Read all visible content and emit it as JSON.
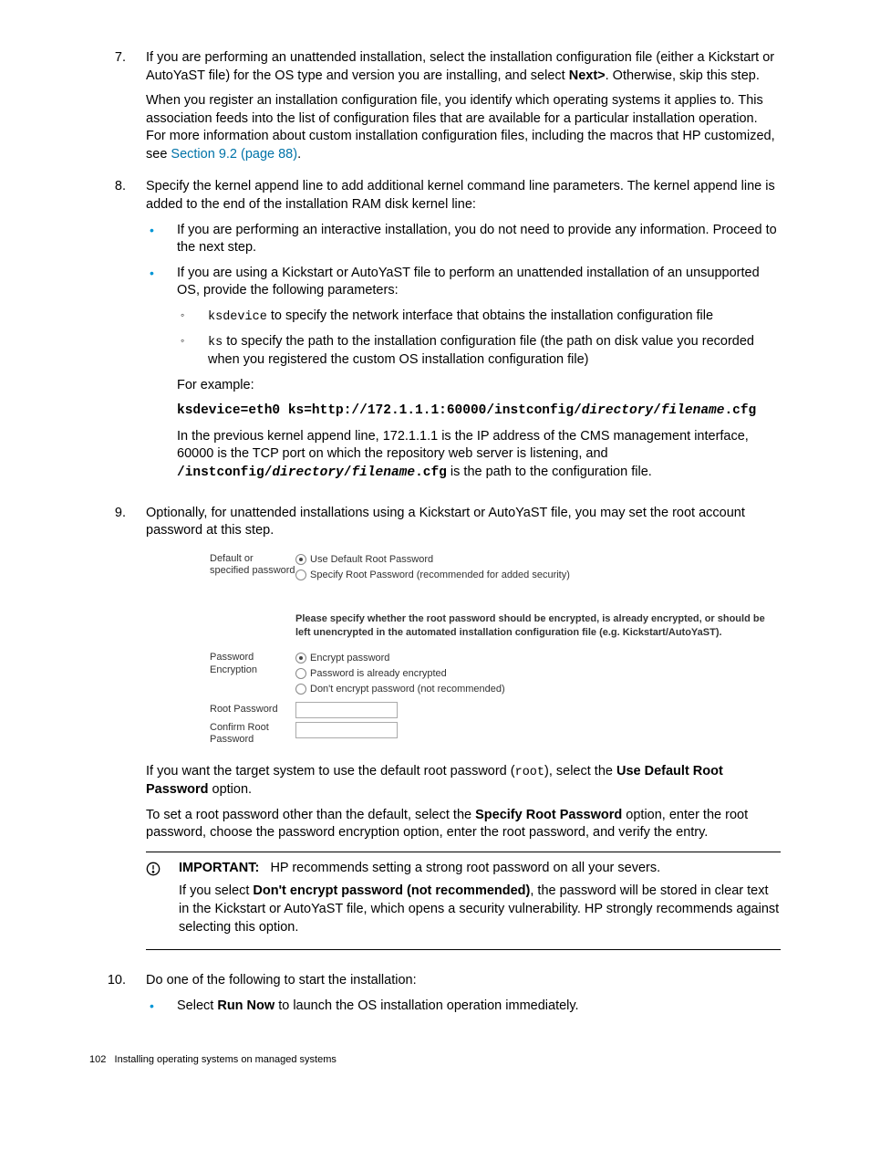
{
  "steps": {
    "s7": {
      "num": "7.",
      "p1a": "If you are performing an unattended installation, select the installation configuration file (either a Kickstart or AutoYaST file) for the OS type and version you are installing, and select ",
      "p1b": "Next>",
      "p1c": ". Otherwise, skip this step.",
      "p2a": "When you register an installation configuration file, you identify which operating systems it applies to. This association feeds into the list of configuration files that are available for a particular installation operation. For more information about custom installation configuration files, including the macros that HP customized, see ",
      "p2link": "Section 9.2 (page 88)",
      "p2b": "."
    },
    "s8": {
      "num": "8.",
      "p1": "Specify the kernel append line to add additional kernel command line parameters. The kernel append line is added to the end of the installation RAM disk kernel line:",
      "b1": "If you are performing an interactive installation, you do not need to provide any information. Proceed to the next step.",
      "b2": "If you are using a Kickstart or AutoYaST file to perform an unattended installation of an unsupported OS, provide the following parameters:",
      "sub1_code": "ksdevice",
      "sub1_rest": " to specify the network interface that obtains the installation configuration file",
      "sub2_code": "ks",
      "sub2_rest": " to specify the path to the installation configuration file (the path on disk value you recorded when you registered the custom OS installation configuration file)",
      "for_example": "For example:",
      "code_a": "ksdevice=eth0 ks=http://172.1.1.1:60000/instconfig/",
      "code_dir": "directory",
      "code_slash": "/",
      "code_file": "filename",
      "code_ext": ".cfg",
      "expl_a": "In the previous kernel append line, 172.1.1.1 is the IP address of the CMS management interface, 60000 is the TCP port on which the repository web server is listening, and ",
      "expl_path_a": "/instconfig/",
      "expl_path_dir": "directory",
      "expl_path_slash": "/",
      "expl_path_file": "filename",
      "expl_path_ext": ".cfg",
      "expl_b": " is the path to the configuration file."
    },
    "s9": {
      "num": "9.",
      "p1": "Optionally, for unattended installations using a Kickstart or AutoYaST file, you may set the root account password at this step.",
      "form": {
        "label1": "Default or specified password",
        "opt1": "Use Default Root Password",
        "opt2": "Specify Root Password (recommended for added security)",
        "note": "Please specify whether the root password should be encrypted, is already encrypted, or should be left unencrypted in the automated installation configuration file (e.g. Kickstart/AutoYaST).",
        "label2": "Password Encryption",
        "enc1": "Encrypt password",
        "enc2": "Password is already encrypted",
        "enc3": "Don't encrypt password (not recommended)",
        "label3": "Root Password",
        "label4": "Confirm Root Password"
      },
      "after1_a": "If you want the target system to use the default root password (",
      "after1_code": "root",
      "after1_b": "), select the ",
      "after1_bold": "Use Default Root Password",
      "after1_c": " option.",
      "after2_a": "To set a root password other than the default, select the ",
      "after2_bold": "Specify Root Password",
      "after2_b": " option, enter the root password, choose the password encryption option, enter the root password, and verify the entry.",
      "important": {
        "label": "IMPORTANT:",
        "line1": "HP recommends setting a strong root password on all your severs.",
        "line2_a": "If you select ",
        "line2_bold": "Don't encrypt password (not recommended)",
        "line2_b": ", the password will be stored in clear text in the Kickstart or AutoYaST file, which opens a security vulnerability. HP strongly recommends against selecting this option."
      }
    },
    "s10": {
      "num": "10.",
      "p1": "Do one of the following to start the installation:",
      "b1_a": "Select ",
      "b1_bold": "Run Now",
      "b1_b": " to launch the OS installation operation immediately."
    }
  },
  "footer": {
    "page": "102",
    "title": "Installing operating systems on managed systems"
  }
}
